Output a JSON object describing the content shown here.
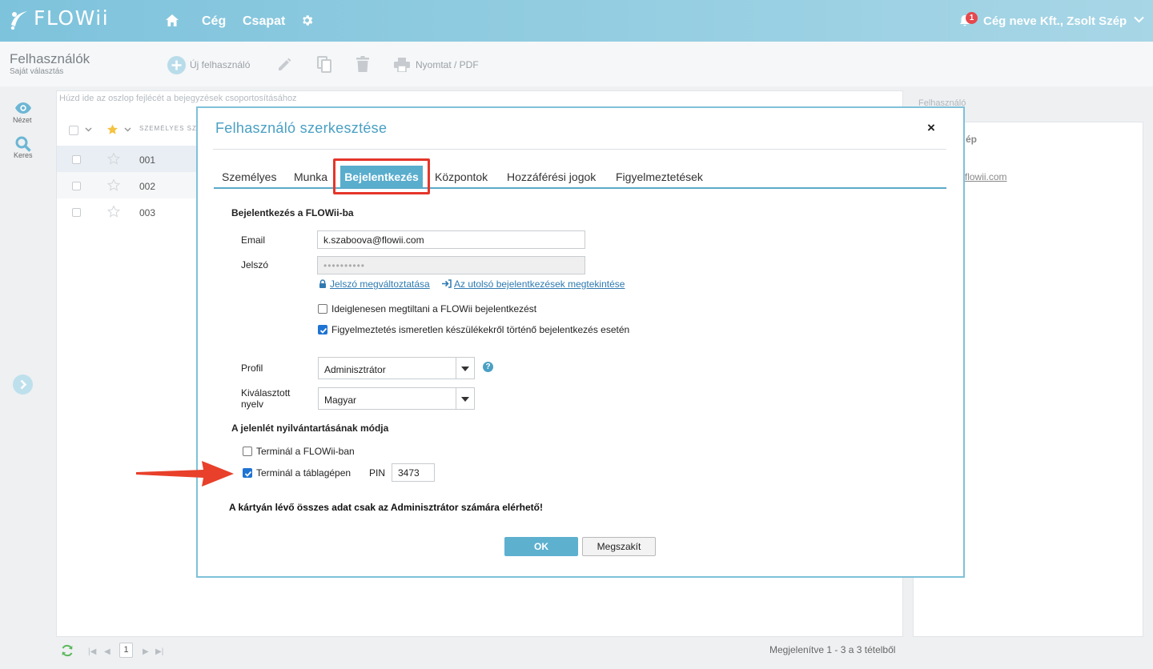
{
  "app": {
    "brand": "FLOWii",
    "nav": [
      "Cég",
      "Csapat"
    ],
    "notification_count": "1",
    "company_user": "Cég neve Kft., Zsolt Szép"
  },
  "page": {
    "title": "Felhasználók",
    "subtitle": "Saját választás"
  },
  "toolbar": {
    "new_user": "Új felhasználó",
    "print": "Nyomtat / PDF"
  },
  "rail": {
    "view": "Nézet",
    "search": "Keres"
  },
  "grid": {
    "group_hint": "Húzd ide az oszlop fejlécét a bejegyzések csoportosításához",
    "column": "SZEMÉLYES SZ",
    "rows": [
      {
        "id": "001",
        "selected": true
      },
      {
        "id": "002",
        "selected": false
      },
      {
        "id": "003",
        "selected": false
      }
    ]
  },
  "right_panel": {
    "title": "Felhasználó",
    "name_fragment": "ép",
    "email_fragment": "va@flowii.com"
  },
  "footer": {
    "first": "|◀",
    "prev": "◀",
    "page": "1",
    "next": "▶",
    "last": "▶|",
    "info": "Megjelenítve 1 - 3 a 3 tételből"
  },
  "modal": {
    "title": "Felhasználó szerkesztése",
    "close": "×",
    "tabs": [
      "Személyes",
      "Munka",
      "Bejelentkezés",
      "Központok",
      "Hozzáférési jogok",
      "Figyelmeztetések"
    ],
    "active_tab": "Bejelentkezés",
    "login_section": "Bejelentkezés a FLOWii-ba",
    "email_label": "Email",
    "email_value": "k.szaboova@flowii.com",
    "password_label": "Jelszó",
    "password_value": "••••••••••",
    "change_password": "Jelszó megváltoztatása",
    "last_logins": "Az utolsó bejelentkezések megtekintése",
    "checkbox_disable": {
      "label": "Ideiglenesen megtiltani a FLOWii bejelentkezést",
      "checked": false
    },
    "checkbox_warn": {
      "label": "Figyelmeztetés ismeretlen készülékekről történő bejelentkezés esetén",
      "checked": true
    },
    "profile_label": "Profil",
    "profile_value": "Adminisztrátor",
    "help": "?",
    "language_label_1": "Kiválasztott",
    "language_label_2": "nyelv",
    "language_value": "Magyar",
    "attendance_section": "A jelenlét nyilvántartásának módja",
    "terminal_flowii": {
      "label": "Terminál a FLOWii-ban",
      "checked": false
    },
    "terminal_tablet": {
      "label": "Terminál a táblagépen",
      "checked": true
    },
    "pin_label": "PIN",
    "pin_value": "3473",
    "warning": "A kártyán lévő összes adat csak az Adminisztrátor számára elérhető!",
    "ok": "OK",
    "cancel": "Megszakít"
  },
  "colors": {
    "accent": "#59adcd",
    "header_gradient": [
      "#7ec3dc",
      "#a7d6e6"
    ],
    "highlight_box": "#e5352a",
    "annotation_arrow": "#e8402a"
  }
}
